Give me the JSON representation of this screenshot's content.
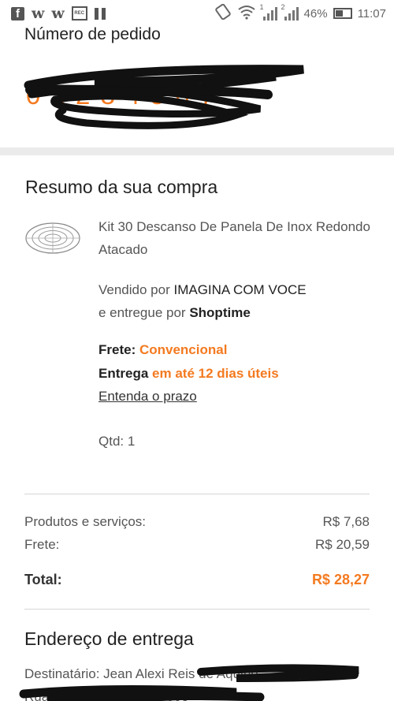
{
  "status_bar": {
    "battery": "46%",
    "time": "11:07",
    "sim1": "1",
    "sim2": "2",
    "icons": [
      "facebook-icon",
      "w-icon",
      "w-icon",
      "rec-icon",
      "book-icon",
      "vibrate-icon",
      "wifi-icon",
      "signal-icon",
      "battery-icon"
    ]
  },
  "order": {
    "label": "Número de pedido",
    "number": "0 1 2 3 4 5 6 7"
  },
  "summary": {
    "title": "Resumo da sua compra",
    "product_name": "Kit 30 Descanso De Panela De Inox Redondo Atacado",
    "sold_by_label": "Vendido por",
    "sold_by": "IMAGINA COM VOCE",
    "delivered_by_label": "e entregue por",
    "delivered_by": "Shoptime",
    "shipping_label": "Frete:",
    "shipping_type": "Convencional",
    "delivery_label": "Entrega",
    "delivery_time": "em até 12 dias úteis",
    "prazo_link": "Entenda o prazo",
    "qty": "Qtd: 1"
  },
  "totals": {
    "products_label": "Produtos e serviços:",
    "products_value": "R$ 7,68",
    "shipping_label": "Frete:",
    "shipping_value": "R$ 20,59",
    "total_label": "Total:",
    "total_value": "R$ 28,27"
  },
  "address": {
    "title": "Endereço de entrega",
    "recipient": "Destinatário: Jean Alexi Reis de Aquino",
    "line": "Rua do Antônio Pereira 999"
  },
  "colors": {
    "accent": "#f47a20",
    "divider": "#ebebeb",
    "rule": "#d6d6d6"
  }
}
